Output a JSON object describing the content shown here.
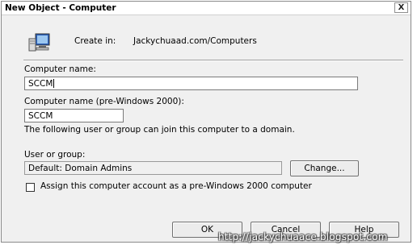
{
  "window": {
    "title": "New Object - Computer",
    "close_glyph": "X"
  },
  "header": {
    "icon": "computer-icon",
    "create_in_label": "Create in:",
    "create_in_path": "Jackychuaad.com/Computers"
  },
  "form": {
    "computer_name_label": "Computer name:",
    "computer_name_value": "SCCM",
    "pre2000_label": "Computer name (pre-Windows 2000):",
    "pre2000_value": "SCCM",
    "join_note": "The following user or group can join this computer to a domain.",
    "user_group_label": "User or group:",
    "user_group_value": "Default: Domain Admins",
    "change_button": "Change...",
    "pre2000_checkbox_label": "Assign this computer account as a pre-Windows 2000 computer",
    "pre2000_checkbox_checked": false
  },
  "buttons": {
    "ok": "OK",
    "cancel": "Cancel",
    "help": "Help"
  },
  "watermark": "http://jackychuaace.blogspot.com"
}
